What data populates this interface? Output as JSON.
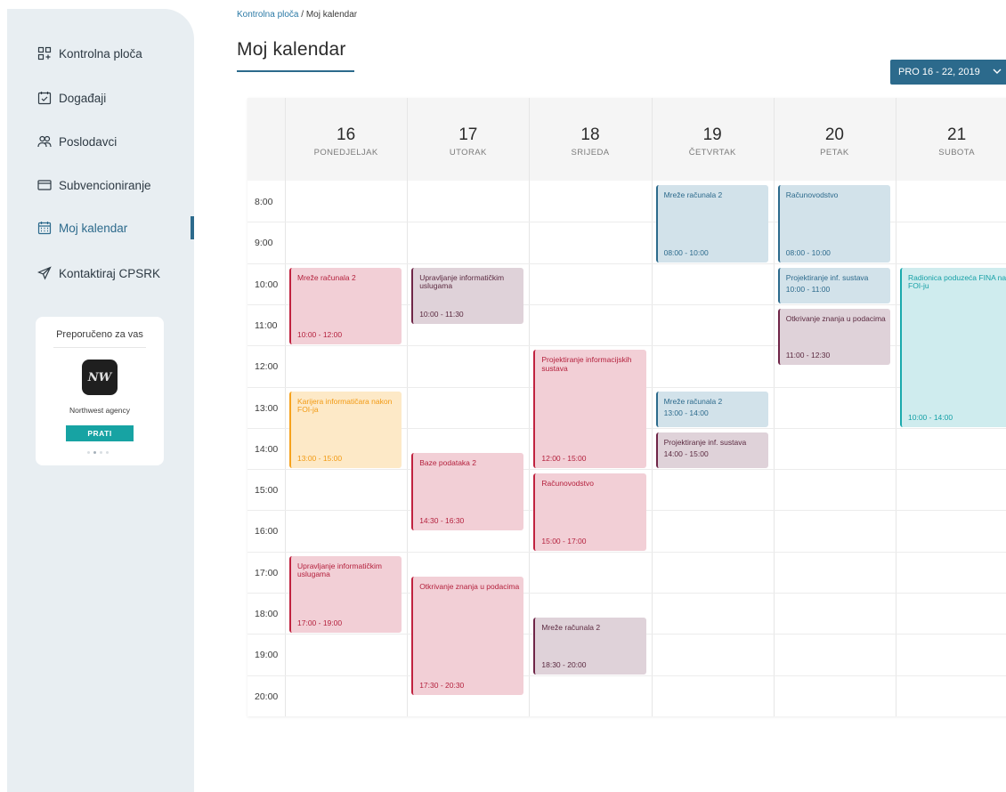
{
  "sidebar": {
    "items": [
      {
        "label": "Kontrolna ploča",
        "icon": "dashboard-icon"
      },
      {
        "label": "Događaji",
        "icon": "calendar-check-icon"
      },
      {
        "label": "Poslodavci",
        "icon": "users-icon"
      },
      {
        "label": "Subvencioniranje",
        "icon": "card-icon"
      },
      {
        "label": "Moj kalendar",
        "icon": "calendar-icon"
      },
      {
        "label": "Kontaktiraj CPSRK",
        "icon": "send-icon"
      }
    ],
    "recommended": {
      "title": "Preporučeno za vas",
      "company": "Northwest agency",
      "logo_text": "NW",
      "follow_label": "PRATI"
    }
  },
  "breadcrumb": {
    "root": "Kontrolna ploča",
    "separator": " / ",
    "current": "Moj kalendar"
  },
  "page_title": "Moj kalendar",
  "week_select": {
    "value": "PRO 16 - 22, 2019"
  },
  "days": [
    {
      "num": "16",
      "name": "PONEDJELJAK"
    },
    {
      "num": "17",
      "name": "UTORAK"
    },
    {
      "num": "18",
      "name": "SRIJEDA"
    },
    {
      "num": "19",
      "name": "ČETVRTAK"
    },
    {
      "num": "20",
      "name": "PETAK"
    },
    {
      "num": "21",
      "name": "SUBOTA"
    }
  ],
  "times": [
    "8:00",
    "9:00",
    "10:00",
    "11:00",
    "12:00",
    "13:00",
    "14:00",
    "15:00",
    "16:00",
    "17:00",
    "18:00",
    "19:00",
    "20:00"
  ],
  "events": [
    {
      "day": 0,
      "title": "Mreže računala 2",
      "time": "10:00 - 12:00",
      "color": "red"
    },
    {
      "day": 0,
      "title": "Karijera informatičara nakon FOI-ja",
      "time": "13:00 - 15:00",
      "color": "orange"
    },
    {
      "day": 0,
      "title": "Upravljanje informatičkim uslugama",
      "time": "17:00 - 19:00",
      "color": "red"
    },
    {
      "day": 1,
      "title": "Upravljanje informatičkim uslugama",
      "time": "10:00 - 11:30",
      "color": "mauve"
    },
    {
      "day": 1,
      "title": "Baze podataka 2",
      "time": "14:30 - 16:30",
      "color": "red"
    },
    {
      "day": 1,
      "title": "Otkrivanje znanja u podacima",
      "time": "17:30 - 20:30",
      "color": "red"
    },
    {
      "day": 2,
      "title": "Projektiranje informacijskih sustava",
      "time": "12:00 - 15:00",
      "color": "red"
    },
    {
      "day": 2,
      "title": "Računovodstvo",
      "time": "15:00 - 17:00",
      "color": "red"
    },
    {
      "day": 2,
      "title": "Mreže računala 2",
      "time": "18:30 - 20:00",
      "color": "mauve"
    },
    {
      "day": 3,
      "title": "Mreže računala 2",
      "time": "08:00 - 10:00",
      "color": "blue"
    },
    {
      "day": 3,
      "title": "Mreže računala 2",
      "time": "13:00 - 14:00",
      "color": "blue"
    },
    {
      "day": 3,
      "title": "Projektiranje inf. sustava",
      "time": "14:00 - 15:00",
      "color": "mauve"
    },
    {
      "day": 4,
      "title": "Računovodstvo",
      "time": "08:00 - 10:00",
      "color": "blue"
    },
    {
      "day": 4,
      "title": "Projektiranje inf. sustava",
      "time": "10:00 - 11:00",
      "color": "blue"
    },
    {
      "day": 4,
      "title": "Otkrivanje znanja u podacima",
      "time": "11:00 - 12:30",
      "color": "mauve"
    },
    {
      "day": 5,
      "title": "Radionica poduzeća FINA na FOI-ju",
      "time": "10:00 - 14:00",
      "color": "teal"
    }
  ]
}
